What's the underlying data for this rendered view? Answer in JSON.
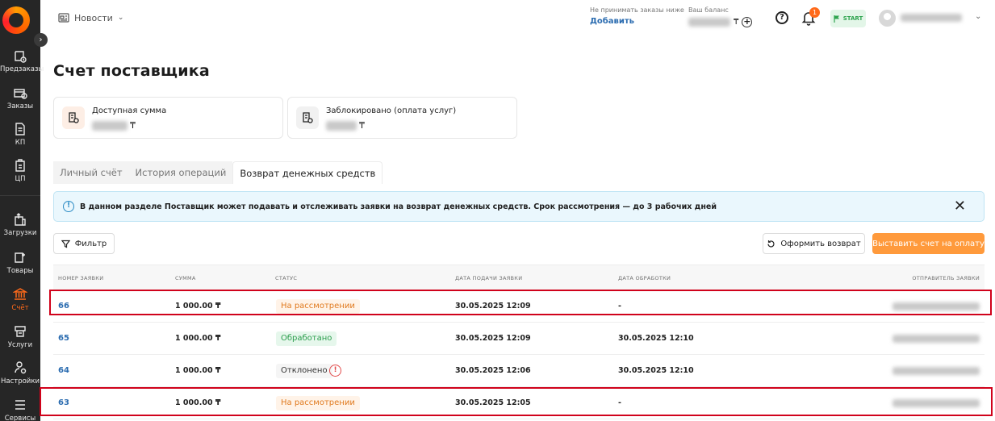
{
  "sidebar": {
    "items": [
      {
        "label": "Предзаказы",
        "icon": "preorder-icon"
      },
      {
        "label": "Заказы",
        "icon": "orders-icon"
      },
      {
        "label": "КП",
        "icon": "document-icon"
      },
      {
        "label": "ЦП",
        "icon": "price-doc-icon"
      },
      {
        "label": "Загрузки",
        "icon": "upload-icon"
      },
      {
        "label": "Товары",
        "icon": "products-icon"
      },
      {
        "label": "Счёт",
        "icon": "bank-icon",
        "active": true
      },
      {
        "label": "Услуги",
        "icon": "services-icon"
      },
      {
        "label": "Настройки",
        "icon": "settings-icon"
      },
      {
        "label": "Сервисы",
        "icon": "menu-icon"
      }
    ]
  },
  "header": {
    "news_label": "Новости",
    "limit_label": "Не принимать заказы ниже",
    "limit_action": "Добавить",
    "balance_label": "Ваш баланс",
    "currency": "₸",
    "notifications_count": "1",
    "plan_label": "START"
  },
  "page": {
    "title": "Счет поставщика",
    "cards": [
      {
        "title": "Доступная сумма",
        "currency": "₸"
      },
      {
        "title": "Заблокировано (оплата услуг)",
        "currency": "₸"
      }
    ],
    "tabs": [
      "Личный счёт",
      "История операций",
      "Возврат денежных средств"
    ],
    "active_tab": 2,
    "info_text": "В данном разделе Поставщик может подавать и отслеживать заявки на возврат денежных средств. Срок рассмотрения — до 3 рабочих дней",
    "filter_label": "Фильтр",
    "refund_button": "Оформить возврат",
    "invoice_button": "Выставить счет на оплату"
  },
  "table": {
    "columns": [
      "НОМЕР ЗАЯВКИ",
      "СУММА",
      "СТАТУС",
      "ДАТА ПОДАЧИ ЗАЯВКИ",
      "ДАТА ОБРАБОТКИ",
      "ОТПРАВИТЕЛЬ ЗАЯВКИ"
    ],
    "rows": [
      {
        "number": "66",
        "amount": "1 000.00 ₸",
        "status": "На рассмотрении",
        "status_type": "pending",
        "submitted": "30.05.2025 12:09",
        "processed": "-"
      },
      {
        "number": "65",
        "amount": "1 000.00 ₸",
        "status": "Обработано",
        "status_type": "done",
        "submitted": "30.05.2025 12:09",
        "processed": "30.05.2025 12:10"
      },
      {
        "number": "64",
        "amount": "1 000.00 ₸",
        "status": "Отклонено",
        "status_type": "rejected",
        "submitted": "30.05.2025 12:06",
        "processed": "30.05.2025 12:10"
      },
      {
        "number": "63",
        "amount": "1 000.00 ₸",
        "status": "На рассмотрении",
        "status_type": "pending",
        "submitted": "30.05.2025 12:05",
        "processed": "-"
      }
    ]
  },
  "colors": {
    "accent": "#ff6a1a",
    "link": "#2b6cb0",
    "highlight": "#d0021b",
    "sidebar_bg": "#262626"
  }
}
